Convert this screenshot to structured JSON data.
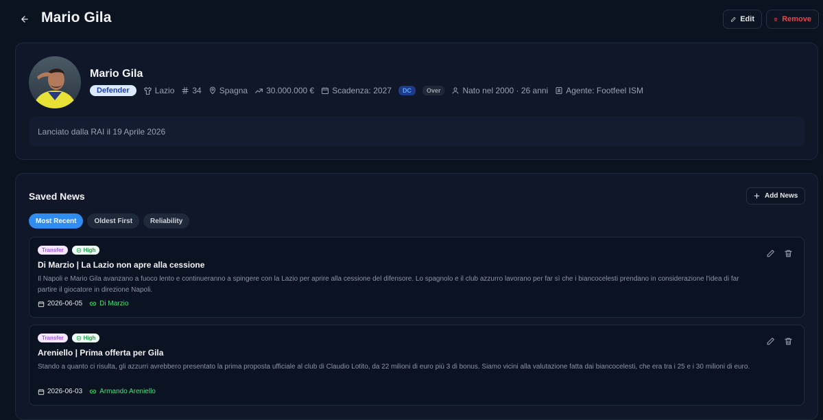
{
  "header": {
    "title": "Mario Gila",
    "edit_label": "Edit",
    "remove_label": "Remove"
  },
  "profile": {
    "name": "Mario Gila",
    "role": "Defender",
    "club": "Lazio",
    "number": "34",
    "nationality": "Spagna",
    "value": "30.000.000 €",
    "contract": "Scadenza: 2027",
    "badge_dc": "DC",
    "badge_over": "Over",
    "born": "Nato nel 2000 · 26 anni",
    "agent": "Agente: Footfeel ISM",
    "note": "Lanciato dalla RAI il 19 Aprile 2026"
  },
  "news_section": {
    "title": "Saved News",
    "add_label": "Add News",
    "sort_tabs": [
      {
        "label": "Most Recent",
        "active": true
      },
      {
        "label": "Oldest First",
        "active": false
      },
      {
        "label": "Reliability",
        "active": false
      }
    ],
    "items": [
      {
        "type": "Transfer",
        "reliability": "High",
        "title": "Di Marzio | La Lazio non apre alla cessione",
        "body": "Il Napoli e Mario Gila avanzano a fuoco lento e continueranno a spingere con la Lazio per aprire alla cessione del difensore. Lo spagnolo e il club azzurro lavorano per far sì che i biancocelesti prendano in considerazione l'idea di far partire il giocatore in direzione Napoli.",
        "date": "2026-06-05",
        "source": "Di Marzio"
      },
      {
        "type": "Transfer",
        "reliability": "High",
        "title": "Areniello | Prima offerta per Gila",
        "body": "Stando a quanto ci risulta, gli azzurri avrebbero presentato la prima proposta ufficiale al club di Claudio Lotito, da 22 milioni di euro più 3 di bonus. Siamo vicini alla valutazione fatta dai biancocelesti, che era tra i 25 e i 30 milioni di euro.",
        "date": "2026-06-03",
        "source": "Armando Areniello"
      }
    ]
  },
  "colors": {
    "background": "#0b1220",
    "card": "#0f1729",
    "accent": "#2f8cf0",
    "danger": "#ef4444",
    "source_link": "#4ade80"
  }
}
